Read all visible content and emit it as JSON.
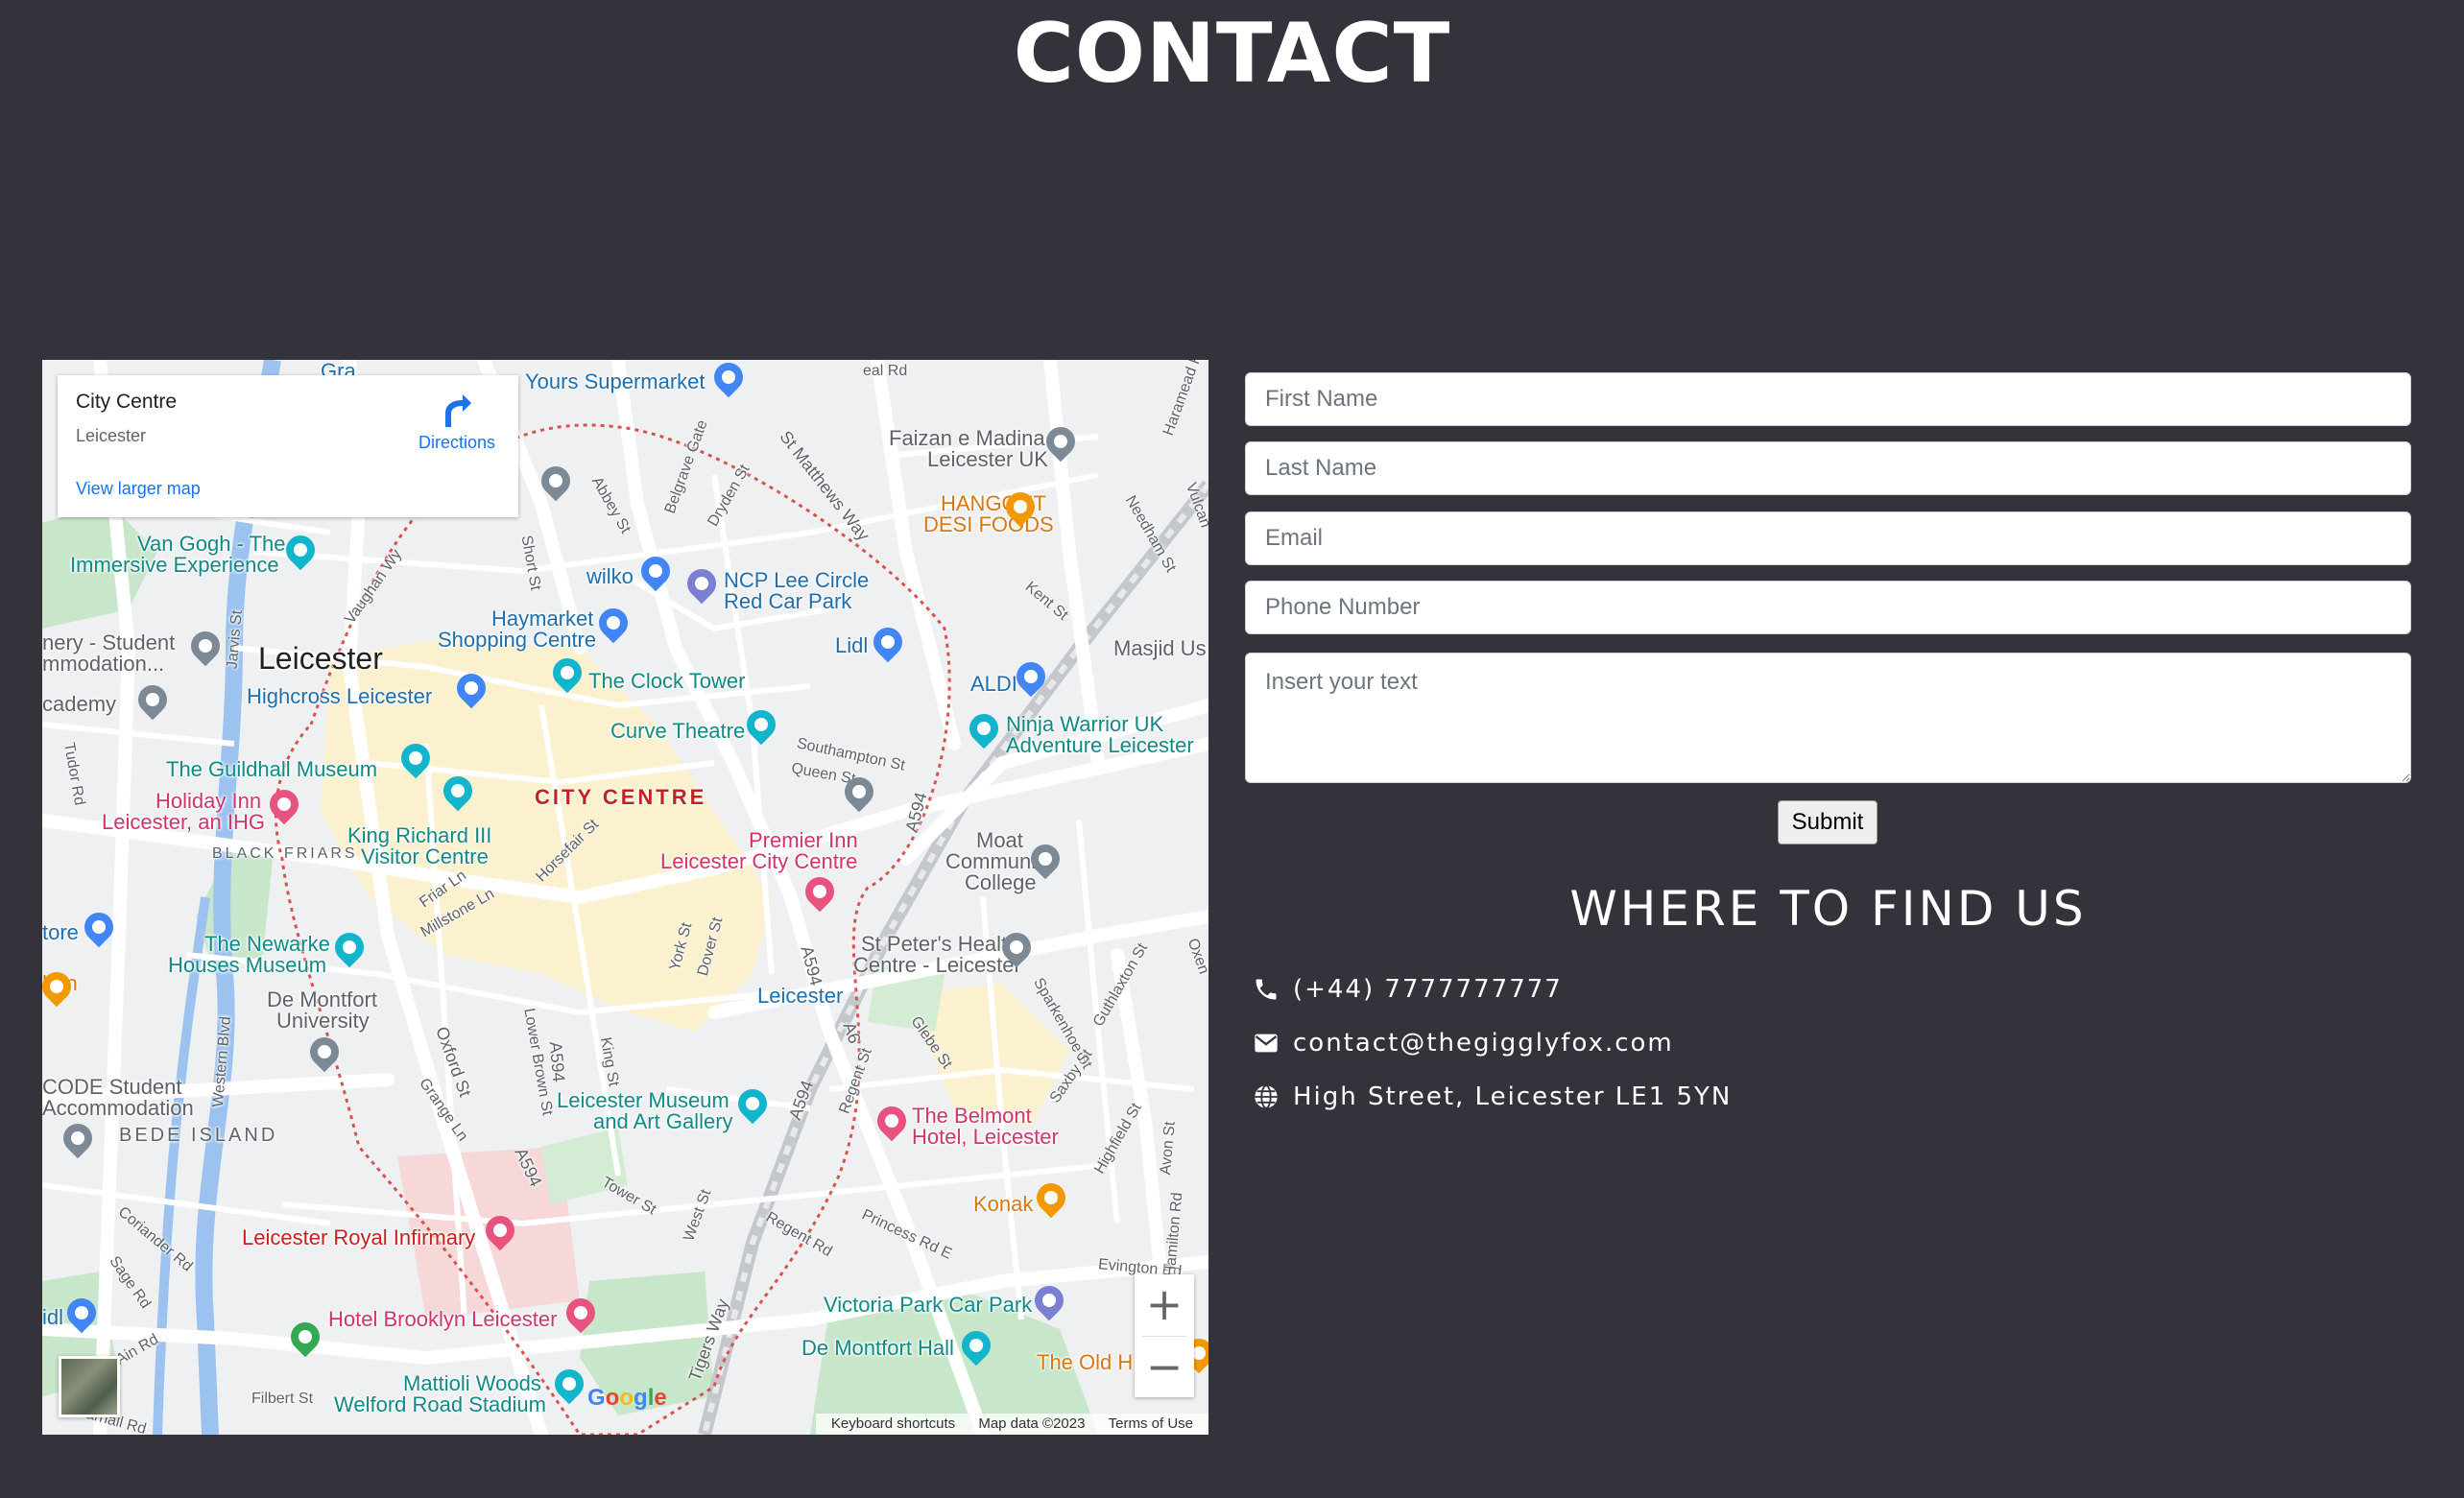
{
  "page": {
    "title": "CONTACT"
  },
  "map": {
    "info_card": {
      "place": "City Centre",
      "locality": "Leicester",
      "view_larger": "View larger map",
      "directions": "Directions"
    },
    "labels": {
      "city": "Leicester",
      "city_centre": "CITY CENTRE",
      "bede_island": "BEDE ISLAND",
      "black_friars": "BLACK FRIARS",
      "yours": "Yours Supermarket",
      "faizan1": "Faizan e Madina",
      "faizan2": "Leicester UK",
      "hangout1": "HANGOUT",
      "hangout2": "DESI FOODS",
      "vangogh1": "Van Gogh - The",
      "vangogh2": "Immersive Experience",
      "wilko": "wilko",
      "ncp1": "NCP Lee Circle",
      "ncp2": "Red Car Park",
      "haymarket1": "Haymarket",
      "haymarket2": "Shopping Centre",
      "lidl": "Lidl",
      "masjid": "Masjid Us",
      "student1": "nery - Student",
      "student2": "mmodation...",
      "highcross": "Highcross Leicester",
      "clocktower": "The Clock Tower",
      "aldi": "ALDI",
      "academy": "cademy",
      "curve": "Curve Theatre",
      "ninja1": "Ninja Warrior UK",
      "ninja2": "Adventure Leicester",
      "guildhall": "The Guildhall Museum",
      "holiday1": "Holiday Inn",
      "holiday2": "Leicester, an IHG",
      "kingrichard1": "King Richard III",
      "kingrichard2": "Visitor Centre",
      "premier1": "Premier Inn",
      "premier2": "Leicester City Centre",
      "moat1": "Moat",
      "moat2": "Community",
      "moat3": "College",
      "store": "tore",
      "newarke1": "The Newarke",
      "newarke2": "Houses Museum",
      "stpeters1": "St Peter's Health",
      "stpeters2": "Centre - Leicester",
      "hen": "hen",
      "demontfort1": "De Montfort",
      "demontfort2": "University",
      "leicester_station": "Leicester",
      "code1": "CODE Student",
      "code2": "Accommodation",
      "museum1": "Leicester Museum",
      "museum2": "and Art Gallery",
      "belmont1": "The Belmont",
      "belmont2": "Hotel, Leicester",
      "konak": "Konak",
      "infirmary": "Leicester Royal Infirmary",
      "victoria": "Victoria Park Car Park",
      "brooklyn": "Hotel Brooklyn Leicester",
      "dmhall": "De Montfort Hall",
      "oldh": "The Old H",
      "mattioli1": "Mattioli Woods",
      "mattioli2": "Welford Road Stadium",
      "idl": "idl",
      "vaughan": "Vaughan Wy",
      "stmatthews": "St Matthews Way",
      "southampton": "Southampton St",
      "queen": "Queen St",
      "a594a": "A594",
      "a594b": "A594",
      "a594c": "A594",
      "a594d": "A594",
      "a594e": "A594",
      "a6": "A6",
      "oxford": "Oxford St",
      "tigers": "Tigers Way",
      "abbey": "Abbey St",
      "belgrave": "Belgrave Gate",
      "dryden": "Dryden St",
      "short": "Short St",
      "jarvis": "Jarvis St",
      "tudor": "Tudor Rd",
      "horsefair": "Horsefair St",
      "friar": "Friar Ln",
      "millstone": "Millstone Ln",
      "york": "York St",
      "dover": "Dover St",
      "kent": "Kent St",
      "needham": "Needham St",
      "western": "Western Blvd",
      "lowerbrown": "Lower Brown St",
      "king": "King St",
      "grange": "Grange Ln",
      "tower": "Tower St",
      "west": "West St",
      "regent": "Regent St",
      "regentrd": "Regent Rd",
      "princess": "Princess Rd E",
      "evington": "Evington Rd",
      "coriander": "Coriander Rd",
      "sage": "Sage Rd",
      "filbert": "Filbert St",
      "glebe": "Glebe St",
      "sparkenhoe": "Sparkenhoe St",
      "guthlaxton": "Guthlaxton St",
      "saxby": "Saxby St",
      "highfield": "Highfield St",
      "avon": "Avon St",
      "hamilton": "Hamilton Rd",
      "gra": "Gra",
      "eal": "eal Rd",
      "haramead": "Haramead Rd",
      "vulcan": "Vulcan",
      "oxen": "Oxen",
      "ain": "Ain Rd",
      "arnall": "arnall Rd"
    },
    "google": "Google",
    "attribution": [
      "Keyboard shortcuts",
      "Map data ©2023",
      "Terms of Use"
    ],
    "zoom_in": "+",
    "zoom_out": "−"
  },
  "form": {
    "first_name": "First Name",
    "last_name": "Last Name",
    "email": "Email",
    "phone": "Phone Number",
    "message": "Insert your text",
    "submit": "Submit"
  },
  "find_us": {
    "title": "WHERE TO FIND US",
    "phone": "(+44) 7777777777",
    "email": "contact@thegigglyfox.com",
    "address": "High Street, Leicester LE1 5YN"
  },
  "colors": {
    "background": "#34333b",
    "text": "#ffffff",
    "input_bg": "#ffffff",
    "map_link": "#1a73e8"
  }
}
